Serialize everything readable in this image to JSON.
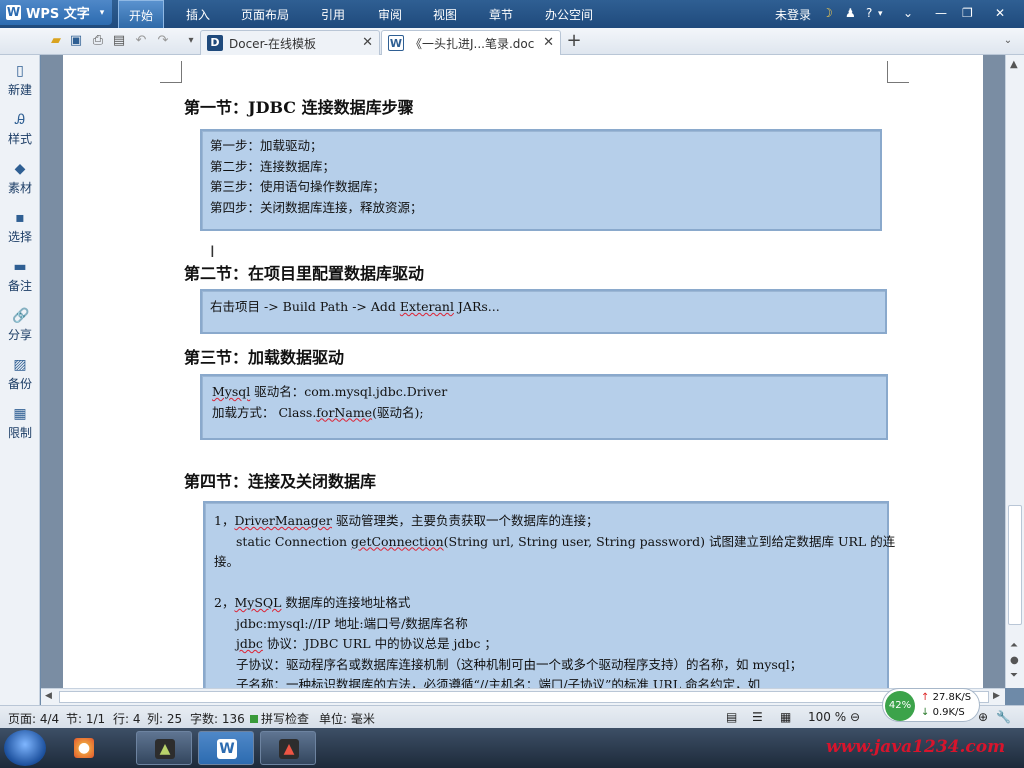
{
  "app": {
    "name": "WPS 文字",
    "logo": "W"
  },
  "menu": {
    "items": [
      {
        "label": "开始",
        "active": true
      },
      {
        "label": "插入"
      },
      {
        "label": "页面布局"
      },
      {
        "label": "引用"
      },
      {
        "label": "审阅"
      },
      {
        "label": "视图"
      },
      {
        "label": "章节"
      },
      {
        "label": "办公空间"
      }
    ],
    "login_label": "未登录",
    "help_label": "?"
  },
  "tabs": [
    {
      "title": "Docer-在线模板",
      "icon": "docer-icon",
      "active": false
    },
    {
      "title": "《一头扎进J...笔录.doc",
      "icon": "doc-icon",
      "active": true
    }
  ],
  "sidebar": {
    "items": [
      {
        "label": "新建",
        "icon": "new-doc-icon"
      },
      {
        "label": "样式",
        "icon": "style-icon"
      },
      {
        "label": "素材",
        "icon": "material-icon"
      },
      {
        "label": "选择",
        "icon": "select-icon"
      },
      {
        "label": "备注",
        "icon": "note-icon"
      },
      {
        "label": "分享",
        "icon": "share-icon"
      },
      {
        "label": "备份",
        "icon": "backup-icon"
      },
      {
        "label": "限制",
        "icon": "restrict-icon"
      }
    ]
  },
  "document": {
    "section1": {
      "heading": "第一节：JDBC 连接数据库步骤",
      "lines": [
        "第一步：加载驱动；",
        "第二步：连接数据库；",
        "第三步：使用语句操作数据库；",
        "第四步：关闭数据库连接，释放资源；"
      ]
    },
    "section2": {
      "heading": "第二节：在项目里配置数据库驱动",
      "line_prefix": "右击项目  ->   Build Path -> Add ",
      "line_word": "Exteranl",
      "line_suffix": " JARs..."
    },
    "section3": {
      "heading": "第三节：加载数据驱动",
      "line1_word": "Mysql",
      "line1_rest": " 驱动名：com.mysql.jdbc.Driver",
      "line2_prefix": "加载方式：        Class.",
      "line2_word": "forName",
      "line2_suffix": "(驱动名);"
    },
    "section4": {
      "heading": "第四节：连接及关闭数据库",
      "p1_num": "1，",
      "p1_word": "DriverManager",
      "p1_rest": "  驱动管理类，主要负责获取一个数据库的连接；",
      "p1_line2_prefix": "static Connection ",
      "p1_line2_word": "getConnection",
      "p1_line2_rest": "(String url, String user, String password)      试图建立到给定数据库  URL  的连",
      "p1_line3": "接。",
      "p2_num": "2，",
      "p2_word": "MySQL",
      "p2_rest": " 数据库的连接地址格式",
      "p2_line2": "jdbc:mysql://IP 地址:端口号/数据库名称",
      "p2_line3_word": "jdbc",
      "p2_line3_rest": " 协议：JDBC URL 中的协议总是  jdbc  ；",
      "p2_line4": "子协议：驱动程序名或数据库连接机制（这种机制可由一个或多个驱动程序支持）的名称，如 mysql；",
      "p2_line5": "子名称：一种标识数据库的方法，必须遵循“//主机名：端口/子协议”的标准 URL 命名约定，如"
    }
  },
  "status": {
    "page": "页面: 4/4",
    "section": "节: 1/1",
    "row": "行: 4",
    "col": "列: 25",
    "words": "字数: 136",
    "spell": "拼写检查",
    "unit": "单位: 毫米",
    "zoom": "100 %"
  },
  "speed": {
    "percent": "42%",
    "up": "27.8K/S",
    "down": "0.9K/S"
  },
  "watermark": "www.java1234.com"
}
